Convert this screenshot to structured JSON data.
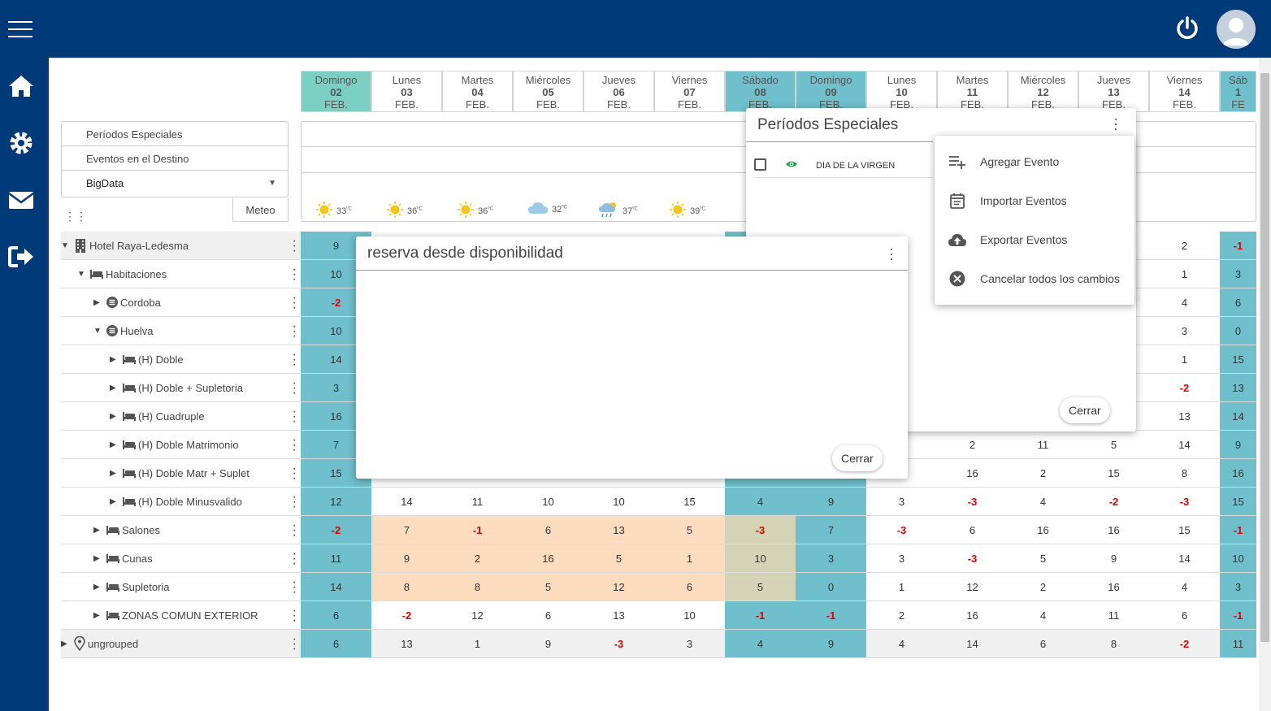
{
  "header": {
    "menu_icon": "hamburger-icon",
    "power_icon": "power-icon",
    "avatar_icon": "user-avatar-icon"
  },
  "sidebar": {
    "items": [
      {
        "icon": "home-icon"
      },
      {
        "icon": "gear-icon"
      },
      {
        "icon": "mail-icon"
      },
      {
        "icon": "logout-icon"
      }
    ]
  },
  "days": [
    {
      "name": "Domingo",
      "num": "02",
      "month": "FEB."
    },
    {
      "name": "Lunes",
      "num": "03",
      "month": "FEB."
    },
    {
      "name": "Martes",
      "num": "04",
      "month": "FEB."
    },
    {
      "name": "Miércoles",
      "num": "05",
      "month": "FEB."
    },
    {
      "name": "Jueves",
      "num": "06",
      "month": "FEB."
    },
    {
      "name": "Viernes",
      "num": "07",
      "month": "FEB."
    },
    {
      "name": "Sábado",
      "num": "08",
      "month": "FEB."
    },
    {
      "name": "Domingo",
      "num": "09",
      "month": "FEB."
    },
    {
      "name": "Lunes",
      "num": "10",
      "month": "FEB."
    },
    {
      "name": "Martes",
      "num": "11",
      "month": "FEB."
    },
    {
      "name": "Miércoles",
      "num": "12",
      "month": "FEB."
    },
    {
      "name": "Jueves",
      "num": "13",
      "month": "FEB."
    },
    {
      "name": "Viernes",
      "num": "14",
      "month": "FEB."
    },
    {
      "name": "Sáb",
      "num": "1",
      "month": "FE"
    }
  ],
  "filters": {
    "periodos": "Períodos Especiales",
    "eventos": "Eventos en el Destino",
    "bigdata": "BigData",
    "meteo": "Meteo"
  },
  "weather": [
    {
      "icon": "sun-icon",
      "temp": "33",
      "unit": "ºC"
    },
    {
      "icon": "sun-icon",
      "temp": "36",
      "unit": "ºC"
    },
    {
      "icon": "sun-icon",
      "temp": "36",
      "unit": "ºC"
    },
    {
      "icon": "cloud-icon",
      "temp": "32",
      "unit": "ºC"
    },
    {
      "icon": "rain-icon",
      "temp": "37",
      "unit": "ºC"
    },
    {
      "icon": "sun-icon",
      "temp": "39",
      "unit": "ºC"
    }
  ],
  "tree": [
    {
      "label": "Hotel Raya-Ledesma",
      "icon": "building-icon",
      "expanded": true
    },
    {
      "label": "Habitaciones",
      "icon": "bed-icon",
      "expanded": true
    },
    {
      "label": "Cordoba",
      "icon": "list-icon",
      "expanded": false
    },
    {
      "label": "Huelva",
      "icon": "list-icon",
      "expanded": true
    },
    {
      "label": "(H) Doble",
      "icon": "bed-icon",
      "expanded": false
    },
    {
      "label": "(H) Doble + Supletoria",
      "icon": "bed-icon",
      "expanded": false
    },
    {
      "label": "(H) Cuadruple",
      "icon": "bed-icon",
      "expanded": false
    },
    {
      "label": "(H) Doble Matrimonio",
      "icon": "bed-icon",
      "expanded": false
    },
    {
      "label": "(H) Doble Matr + Suplet",
      "icon": "bed-icon",
      "expanded": false
    },
    {
      "label": "(H) Doble Minusvalido",
      "icon": "bed-icon",
      "expanded": false
    },
    {
      "label": "Salones",
      "icon": "bed-icon",
      "expanded": false
    },
    {
      "label": "Cunas",
      "icon": "bed-icon",
      "expanded": false
    },
    {
      "label": "Supletoria",
      "icon": "bed-icon",
      "expanded": false
    },
    {
      "label": "ZONAS COMUN EXTERIOR",
      "icon": "bed-icon",
      "expanded": false
    },
    {
      "label": "ungrouped",
      "icon": "location-icon",
      "expanded": false
    }
  ],
  "grid": [
    [
      "9",
      "",
      "",
      "",
      "",
      "",
      "",
      "",
      "",
      "",
      "",
      "",
      "2",
      "-1"
    ],
    [
      "10",
      "",
      "",
      "",
      "",
      "",
      "",
      "",
      "",
      "",
      "",
      "",
      "1",
      "3"
    ],
    [
      "-2",
      "",
      "",
      "",
      "",
      "",
      "",
      "",
      "",
      "",
      "",
      "",
      "4",
      "6"
    ],
    [
      "10",
      "",
      "",
      "",
      "",
      "",
      "",
      "",
      "",
      "",
      "",
      "",
      "3",
      "0"
    ],
    [
      "14",
      "",
      "",
      "",
      "",
      "",
      "",
      "",
      "",
      "",
      "",
      "",
      "1",
      "15"
    ],
    [
      "3",
      "",
      "",
      "",
      "",
      "",
      "",
      "",
      "",
      "",
      "",
      "",
      "-2",
      "13"
    ],
    [
      "16",
      "",
      "",
      "",
      "",
      "",
      "",
      "",
      "",
      "",
      "",
      "",
      "13",
      "14"
    ],
    [
      "7",
      "",
      "",
      "",
      "",
      "",
      "",
      "",
      "",
      "2",
      "11",
      "5",
      "14",
      "9"
    ],
    [
      "15",
      "",
      "",
      "",
      "",
      "",
      "",
      "",
      "",
      "16",
      "2",
      "15",
      "8",
      "16"
    ],
    [
      "12",
      "14",
      "11",
      "10",
      "10",
      "15",
      "4",
      "9",
      "3",
      "-3",
      "4",
      "-2",
      "-3",
      "15"
    ],
    [
      "-2",
      "7",
      "-1",
      "6",
      "13",
      "5",
      "-3",
      "7",
      "-3",
      "6",
      "16",
      "16",
      "15",
      "-1"
    ],
    [
      "11",
      "9",
      "2",
      "16",
      "5",
      "1",
      "10",
      "3",
      "3",
      "-3",
      "5",
      "9",
      "14",
      "10"
    ],
    [
      "14",
      "8",
      "8",
      "5",
      "12",
      "6",
      "5",
      "0",
      "1",
      "12",
      "2",
      "16",
      "4",
      "3"
    ],
    [
      "6",
      "-2",
      "12",
      "6",
      "13",
      "10",
      "-1",
      "-1",
      "2",
      "16",
      "4",
      "11",
      "6",
      "-1"
    ],
    [
      "6",
      "13",
      "1",
      "9",
      "-3",
      "3",
      "4",
      "9",
      "4",
      "14",
      "6",
      "8",
      "-2",
      "11"
    ]
  ],
  "periodos_dialog": {
    "title": "Períodos Especiales",
    "event": "DIA DE LA VIRGEN",
    "close": "Cerrar"
  },
  "context_menu": {
    "items": [
      {
        "label": "Agregar Evento",
        "icon": "playlist-add-icon"
      },
      {
        "label": "Importar Eventos",
        "icon": "calendar-import-icon"
      },
      {
        "label": "Exportar Eventos",
        "icon": "cloud-upload-icon"
      },
      {
        "label": "Cancelar todos los cambios",
        "icon": "cancel-circle-icon"
      }
    ]
  },
  "reserva_dialog": {
    "title": "reserva desde disponibilidad",
    "close": "Cerrar"
  }
}
